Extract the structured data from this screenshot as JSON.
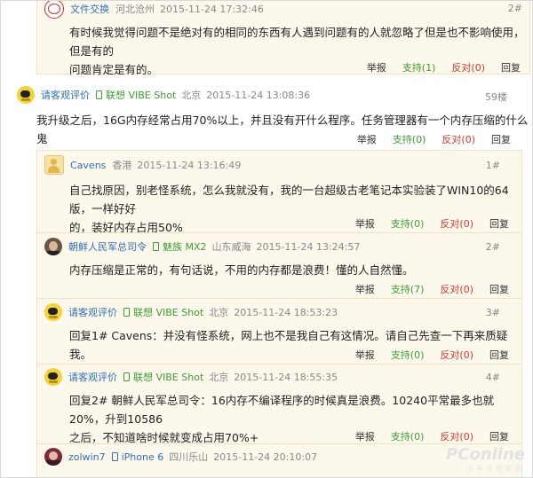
{
  "comments": {
    "top": {
      "user": "文件交换",
      "location": "河北沧州",
      "time": "2015-11-24 17:32:46",
      "floor": "2#",
      "body_line1": "有时候我觉得问题不是绝对有的相同的东西有人遇到问题有的人就忽略了但是也不影响使用，但是有的",
      "body_line2": "问题肯定是有的。",
      "report": "举报",
      "support": "支持(1)",
      "oppose": "反对(0)",
      "reply": "回复"
    },
    "main": {
      "user": "请客观评价",
      "device": "联想 VIBE Shot",
      "location": "北京",
      "time": "2015-11-24 13:08:36",
      "floor": "59楼",
      "body": "我升级之后，16G内存经常占用70%以上，并且没有开什么程序。任务管理器有一个内存压缩的什么鬼",
      "report": "举报",
      "support": "支持(0)",
      "oppose": "反对(0)",
      "reply": "回复"
    },
    "r1": {
      "user": "Cavens",
      "location": "香港",
      "time": "2015-11-24 13:16:49",
      "floor": "1#",
      "body_line1": "自己找原因，别老怪系统，怎么我就没有，我的一台超级古老笔记本实验装了WIN10的64版，一样好好",
      "body_line2": "的，装好内存占用50%",
      "report": "举报",
      "support": "支持(0)",
      "oppose": "反对(0)",
      "reply": "回复"
    },
    "r2": {
      "user": "朝鲜人民军总司令",
      "device": "魅族 MX2",
      "location": "山东威海",
      "time": "2015-11-24 13:24:57",
      "floor": "2#",
      "body": "内存压缩是正常的，有句话说，不用的内存都是浪费！懂的人自然懂。",
      "report": "举报",
      "support": "支持(7)",
      "oppose": "反对(0)",
      "reply": "回复"
    },
    "r3": {
      "user": "请客观评价",
      "device": "联想 VIBE Shot",
      "location": "北京",
      "time": "2015-11-24 18:53:23",
      "floor": "3#",
      "body": "回复1# Cavens：并没有怪系统，网上也不是我自己有这情况。请自己先查一下再来质疑我。",
      "report": "举报",
      "support": "支持(0)",
      "oppose": "反对(0)",
      "reply": "回复"
    },
    "r4": {
      "user": "请客观评价",
      "device": "联想 VIBE Shot",
      "location": "北京",
      "time": "2015-11-24 18:55:35",
      "floor": "4#",
      "body_line1": "回复2# 朝鲜人民军总司令：16内存不编译程序的时候真是浪费。10240平常最多也就20%，升到10586",
      "body_line2": "之后，不知道啥时候就变成占用70%+",
      "report": "举报",
      "support": "支持(0)",
      "oppose": "反对(0)",
      "reply": "回复"
    },
    "r5": {
      "user": "zolwin7",
      "device": "iPhone 6",
      "location": "四川乐山",
      "time": "2015-11-24 20:10:07"
    }
  },
  "watermark": {
    "brand": "PConline",
    "sub": "太平洋电脑网"
  },
  "colors": {
    "username": "#2f6fb5",
    "device": "#3f9a35",
    "support": "#3f9a35",
    "oppose": "#d23a2f",
    "quote_bg": "#fdf8ec"
  }
}
